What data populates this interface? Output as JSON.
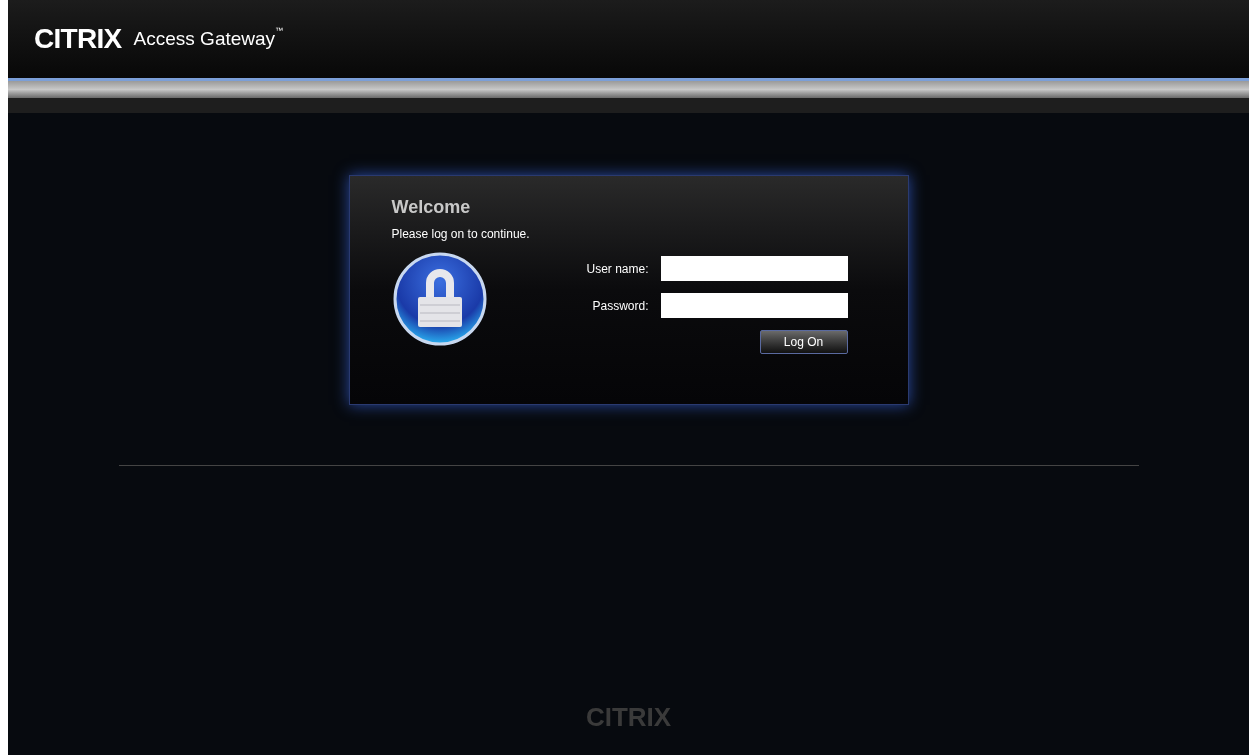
{
  "header": {
    "logo": "CITRIX",
    "product": "Access Gateway",
    "trademark": "™"
  },
  "login": {
    "title": "Welcome",
    "subtitle": "Please log on to continue.",
    "fields": [
      {
        "label": "User name:"
      },
      {
        "label": "Password:"
      }
    ],
    "button": "Log On"
  },
  "footer": {
    "logo": "CITRIX"
  }
}
